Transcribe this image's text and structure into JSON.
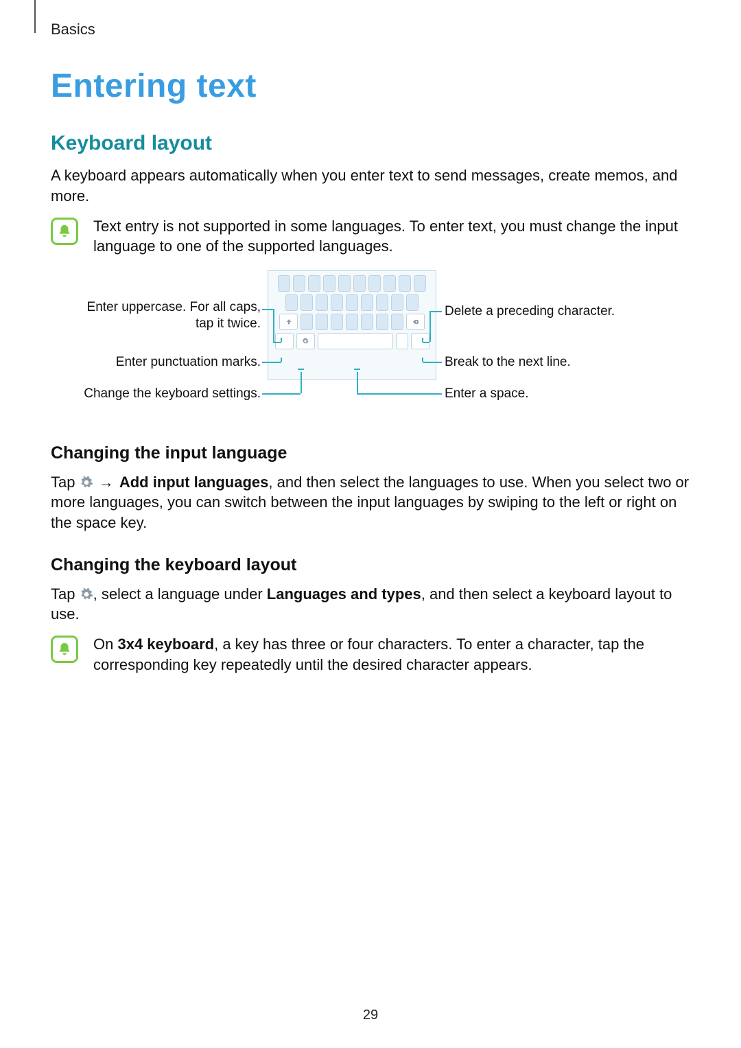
{
  "breadcrumb": "Basics",
  "page_number": "29",
  "h1": "Entering text",
  "h2": "Keyboard layout",
  "intro": "A keyboard appears automatically when you enter text to send messages, create memos, and more.",
  "note1": "Text entry is not supported in some languages. To enter text, you must change the input language to one of the supported languages.",
  "diagram": {
    "left1": "Enter uppercase. For all caps, tap it twice.",
    "left2": "Enter punctuation marks.",
    "left3": "Change the keyboard settings.",
    "right1": "Delete a preceding character.",
    "right2": "Break to the next line.",
    "right3": "Enter a space."
  },
  "h3a": "Changing the input language",
  "para_a": {
    "pre": "Tap ",
    "arrow": "→",
    "bold": "Add input languages",
    "post": ", and then select the languages to use. When you select two or more languages, you can switch between the input languages by swiping to the left or right on the space key."
  },
  "h3b": "Changing the keyboard layout",
  "para_b": {
    "pre": "Tap ",
    "mid1": ", select a language under ",
    "bold": "Languages and types",
    "post": ", and then select a keyboard layout to use."
  },
  "note2": {
    "pre": "On ",
    "bold": "3x4 keyboard",
    "post": ", a key has three or four characters. To enter a character, tap the corresponding key repeatedly until the desired character appears."
  }
}
